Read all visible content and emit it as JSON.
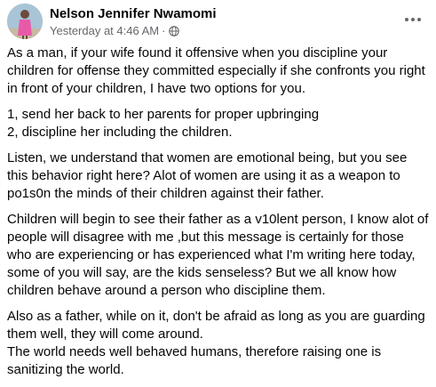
{
  "post": {
    "author": "Nelson Jennifer Nwamomi",
    "timestamp": "Yesterday at 4:46 AM",
    "separator": "·",
    "privacy_icon": "globe-icon",
    "more_icon": "more-options-icon",
    "paragraphs": [
      "As a man, if your wife found it offensive when you  discipline your\nchildren for offense they committed especially if she confronts you right\nin front of your children, I have two options for you.",
      "1, send her back to her parents for proper upbringing\n2, discipline her including the children.",
      "Listen, we understand that women are emotional being, but you see\nthis behavior right here? Alot of women are using it as a weapon to\npo1s0n the minds of their children against their father.",
      "Children will begin to see their father as a v10lent person, I know alot of\npeople will disagree with me ,but this message is certainly for those\nwho are experiencing or has experienced what I'm writing here today,\nsome of you will say, are the kids senseless? But we all know how\nchildren behave around a person who discipline them.",
      "Also as a father, while on it, don't be afraid as long as you are guarding\nthem well, they will come around.\nThe world needs well behaved humans, therefore raising one is\nsanitizing the world."
    ]
  }
}
